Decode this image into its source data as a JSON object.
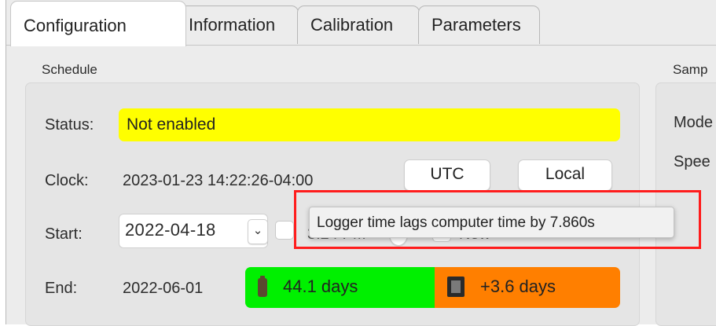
{
  "tabs": [
    {
      "label": "Configuration",
      "active": true
    },
    {
      "label": "Information"
    },
    {
      "label": "Calibration"
    },
    {
      "label": "Parameters"
    }
  ],
  "schedule": {
    "title": "Schedule",
    "status_label": "Status:",
    "status_value": "Not enabled",
    "status_color": "#ffff00",
    "clock_label": "Clock:",
    "clock_value": "2023-01-23 14:22:26-04:00",
    "utc_button": "UTC",
    "local_button": "Local",
    "start_label": "Start:",
    "start_date": "2022-04-18",
    "now_label": "Now",
    "end_label": "End:",
    "end_date": "2022-06-01",
    "battery_days": "44.1 days",
    "battery_color": "#00f000",
    "memory_days": "+3.6 days",
    "memory_color": "#ff7f00"
  },
  "sampling": {
    "title": "Samp",
    "mode_label": "Mode",
    "speed_label": "Spee"
  },
  "tooltip": "Logger time lags computer time by 7.860s",
  "highlight_color": "#ff1c1c"
}
